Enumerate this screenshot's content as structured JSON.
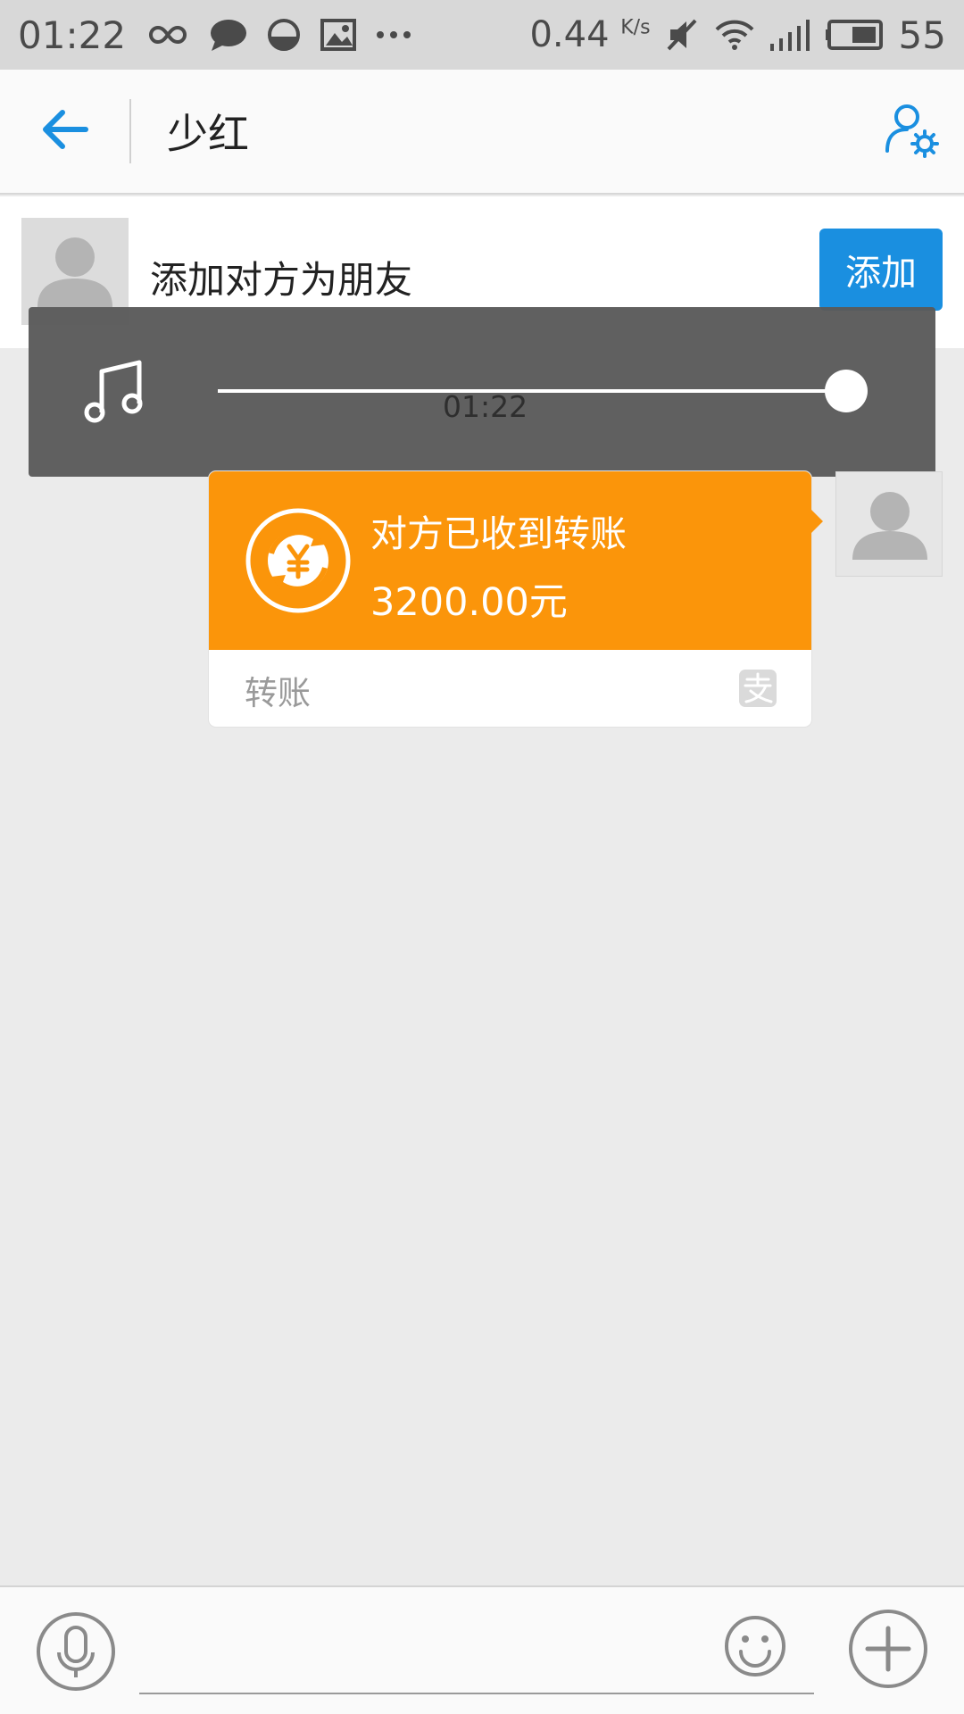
{
  "status_bar": {
    "time": "01:22",
    "icons_left": [
      "infinity-icon",
      "chat-bubble-icon",
      "half-circle-icon",
      "image-icon",
      "more-dots-icon"
    ],
    "net_speed_value": "0.44",
    "net_speed_unit": "K/s",
    "icons_right": [
      "mute-icon",
      "wifi-icon",
      "signal-icon",
      "battery-icon"
    ],
    "battery": "55"
  },
  "header": {
    "title": "少红",
    "back_icon": "back-arrow-icon",
    "settings_icon": "profile-settings-icon",
    "accent": "#1a8fe0"
  },
  "add_friend": {
    "prompt": "添加对方为朋友",
    "button_label": "添加"
  },
  "music_overlay": {
    "time": "01:22",
    "progress": 1.0
  },
  "transfer": {
    "status": "对方已收到转账",
    "amount": "3200.00元",
    "label": "转账",
    "color": "#fb950a"
  },
  "input_bar": {
    "placeholder": ""
  }
}
